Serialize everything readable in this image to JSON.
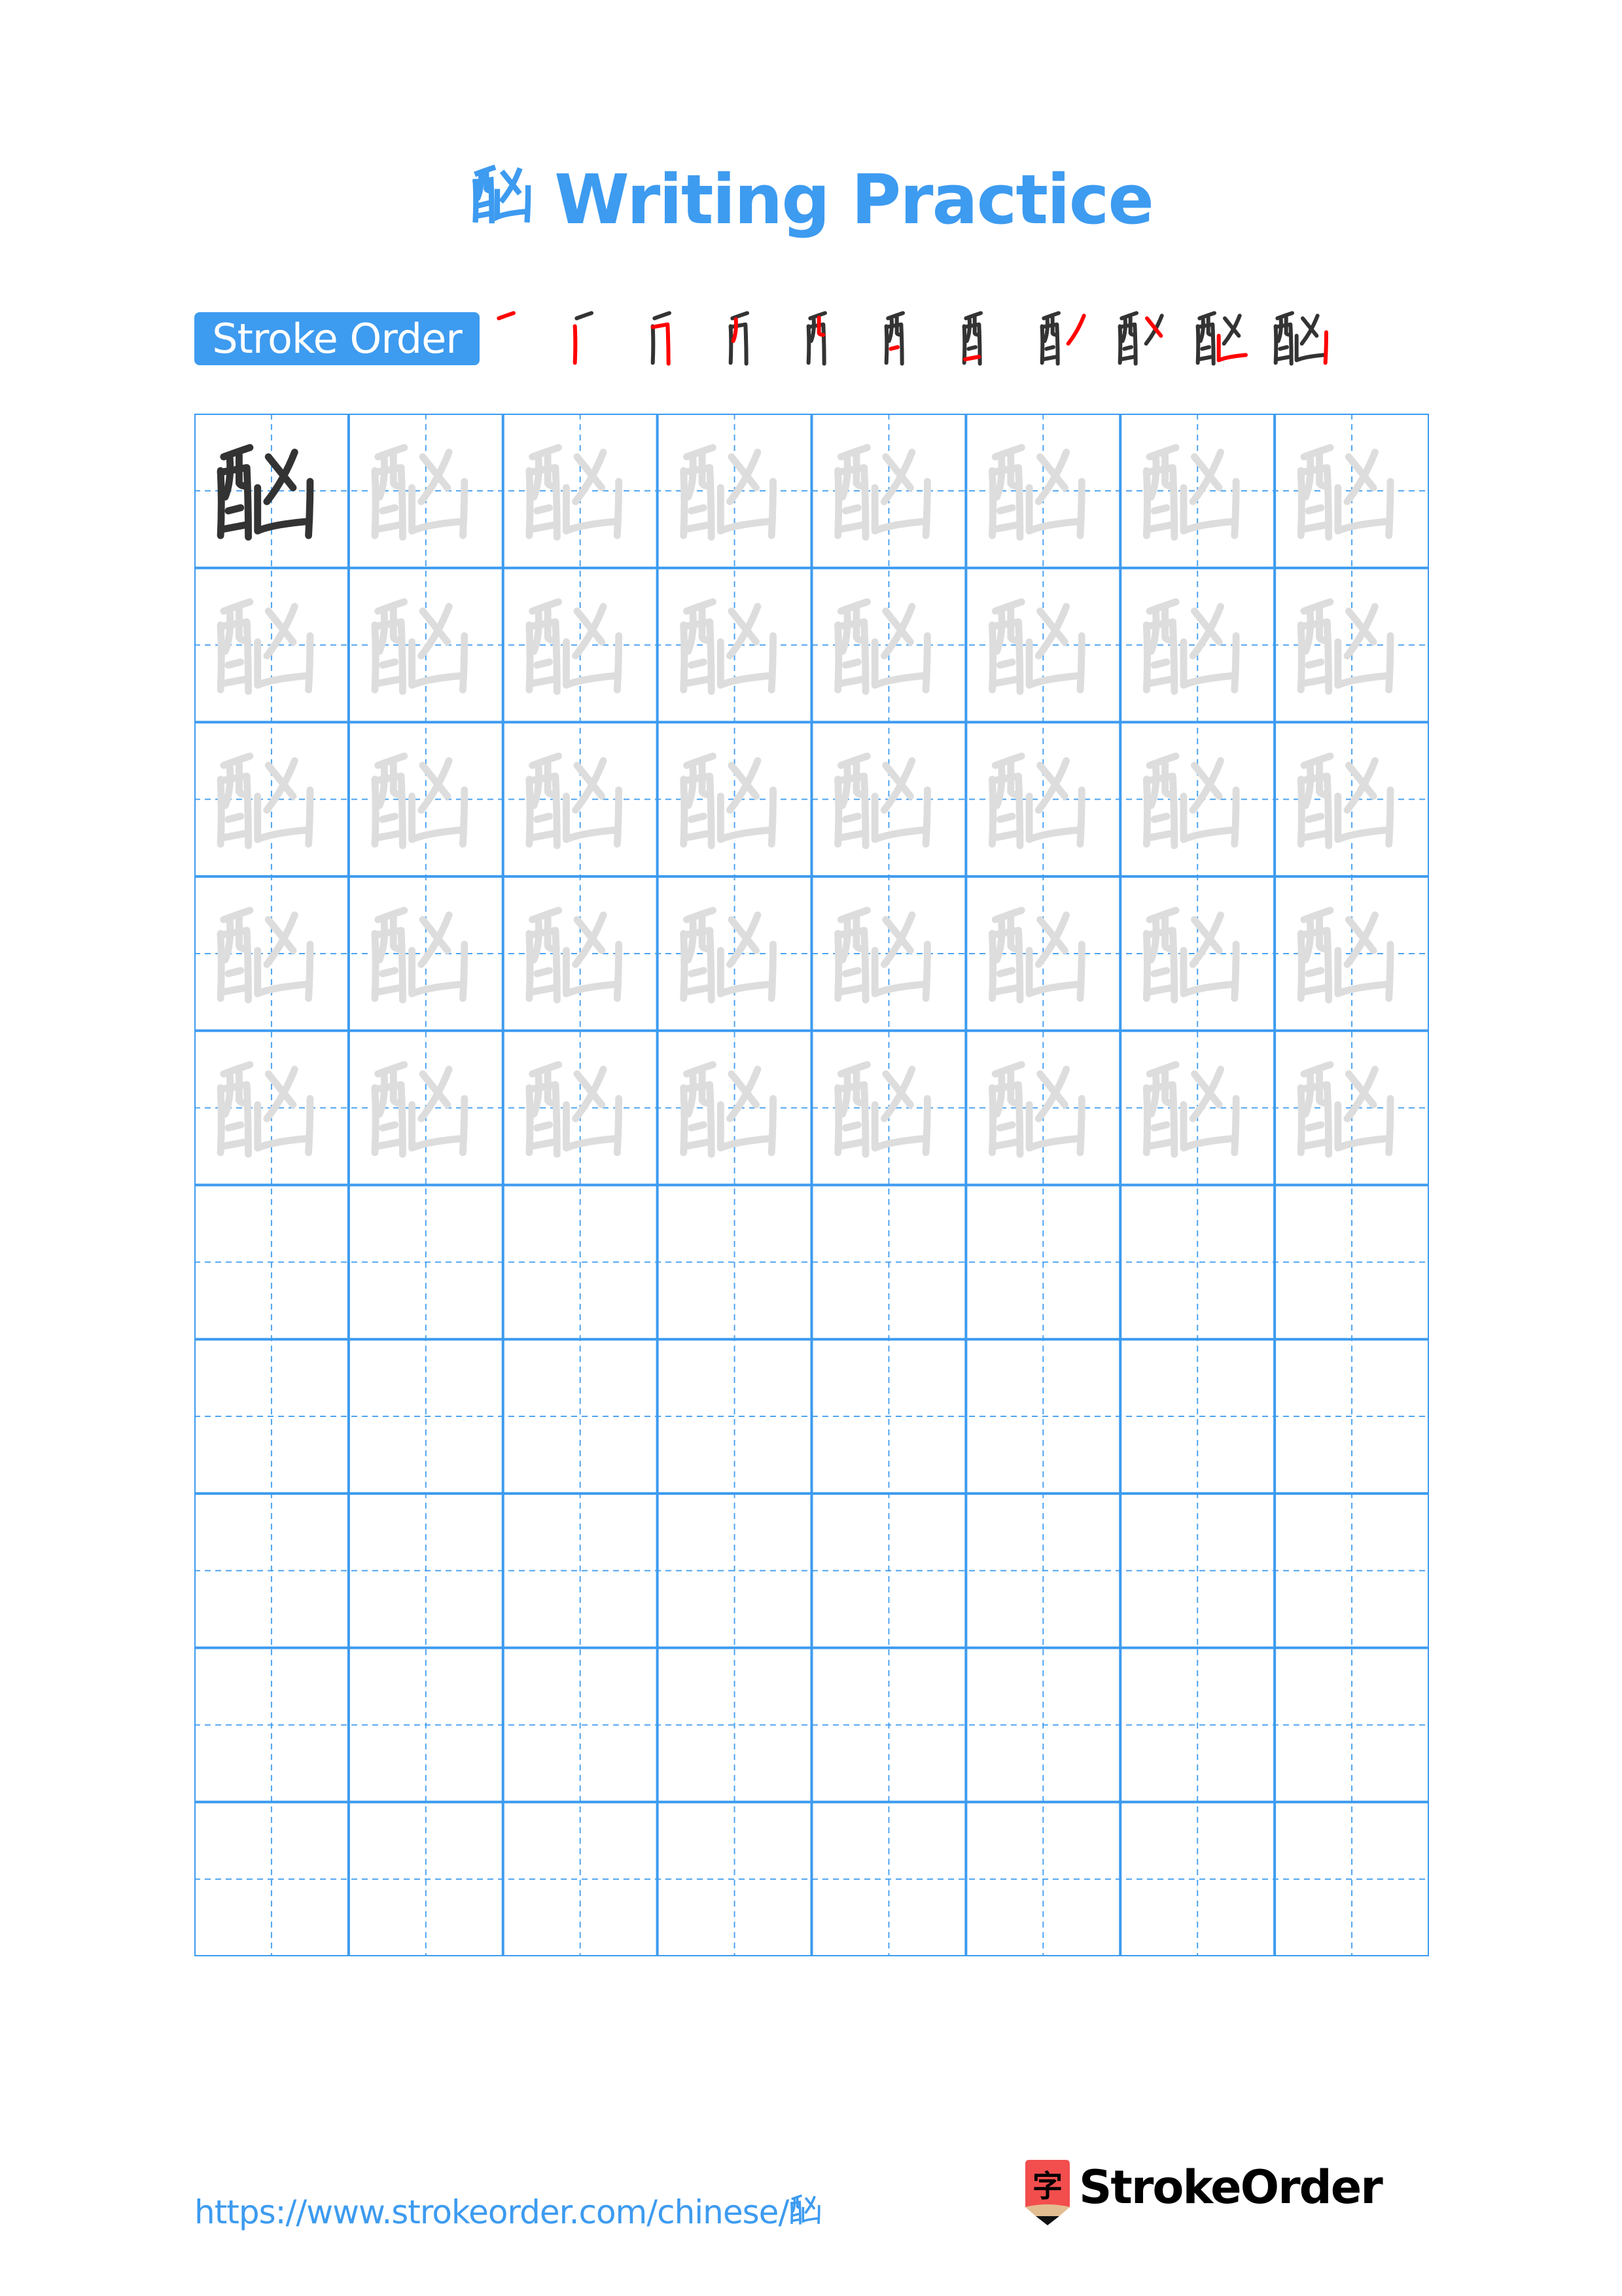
{
  "page": {
    "title_char": "酗",
    "title_suffix": "Writing Practice",
    "accent_color": "#3d9bf0"
  },
  "stroke_order": {
    "label": "Stroke Order",
    "total_strokes": 11,
    "highlight_color": "#ff0000",
    "ink_color": "#333333"
  },
  "practice_grid": {
    "character": "酗",
    "columns": 8,
    "rows": 10,
    "model_cells": 1,
    "traced_rows": 5,
    "empty_rows": 5,
    "model_color": "#333333",
    "trace_color": "#dddddd",
    "line_color": "#3d9bf0"
  },
  "footer": {
    "url_prefix": "https://www.strokeorder.com/chinese/",
    "url_char": "酗",
    "brand_name": "StrokeOrder",
    "logo_glyph": "字"
  }
}
